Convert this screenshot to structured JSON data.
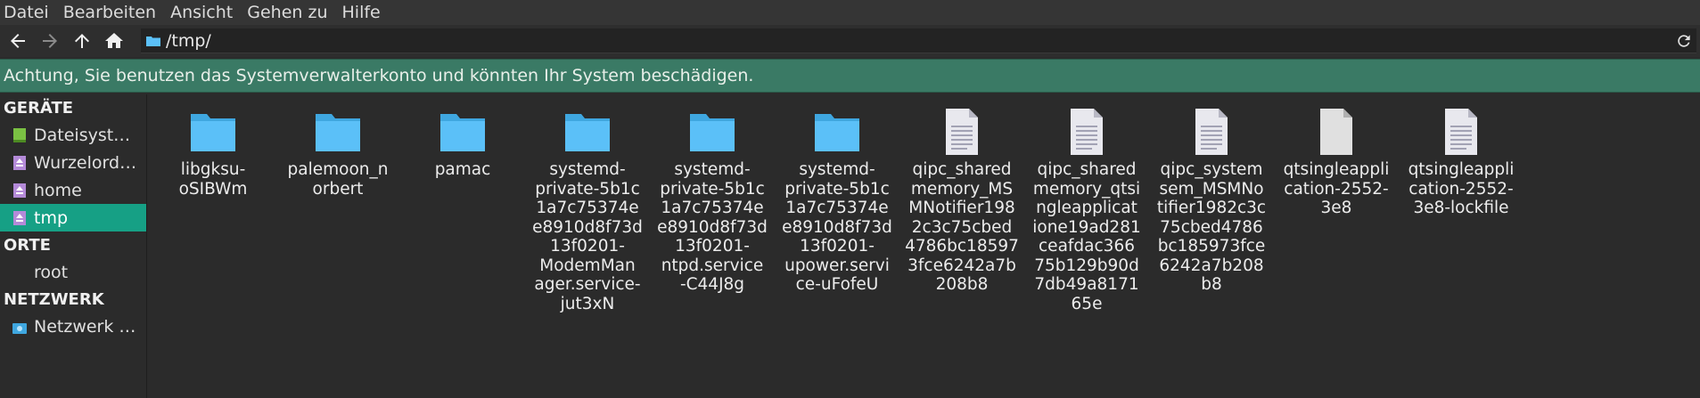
{
  "menu": [
    "Datei",
    "Bearbeiten",
    "Ansicht",
    "Gehen zu",
    "Hilfe"
  ],
  "address": {
    "path": "/tmp/"
  },
  "warning": "Achtung, Sie benutzen das Systemverwalterkonto und könnten Ihr System beschädigen.",
  "sidebar": {
    "sections": [
      {
        "title": "GERÄTE",
        "items": [
          {
            "label": "Dateisyst…",
            "icon": "drive-icon"
          },
          {
            "label": "Wurzelord…",
            "icon": "eject-drive-icon"
          },
          {
            "label": "home",
            "icon": "eject-drive-icon"
          },
          {
            "label": "tmp",
            "icon": "eject-drive-icon",
            "active": true
          }
        ]
      },
      {
        "title": "ORTE",
        "items": [
          {
            "label": "root",
            "icon": ""
          }
        ]
      },
      {
        "title": "NETZWERK",
        "items": [
          {
            "label": "Netzwerk …",
            "icon": "network-icon"
          }
        ]
      }
    ]
  },
  "files": [
    {
      "name": "libgksu-oSIBWm",
      "type": "folder"
    },
    {
      "name": "palemoon_norbert",
      "type": "folder"
    },
    {
      "name": "pamac",
      "type": "folder"
    },
    {
      "name": "systemd-private-5b1c1a7c75374ee8910d8f73d13f0201-ModemManager.service-jut3xN",
      "type": "folder"
    },
    {
      "name": "systemd-private-5b1c1a7c75374ee8910d8f73d13f0201-ntpd.service-C44J8g",
      "type": "folder"
    },
    {
      "name": "systemd-private-5b1c1a7c75374ee8910d8f73d13f0201-upower.service-uFofeU",
      "type": "folder"
    },
    {
      "name": "qipc_sharedmemory_MSMNotifier1982c3c75cbed4786bc185973fce6242a7b208b8",
      "type": "text"
    },
    {
      "name": "qipc_sharedmemory_qtsingleapplicatione19ad281ceafdac36675b129b90d7db49a817165e",
      "type": "text"
    },
    {
      "name": "qipc_systemsem_MSMNotifier1982c3c75cbed4786bc185973fce6242a7b208b8",
      "type": "text"
    },
    {
      "name": "qtsingleapplication-2552-3e8",
      "type": "blank"
    },
    {
      "name": "qtsingleapplication-2552-3e8-lockfile",
      "type": "text"
    }
  ],
  "file_lines": [
    [
      "libgksu-",
      "oSIBWm"
    ],
    [
      "palemoon_n",
      "orbert"
    ],
    [
      "pamac"
    ],
    [
      "systemd-",
      "private-5b1c",
      "1a7c75374e",
      "e8910d8f73d",
      "13f0201-",
      "ModemMan",
      "ager.service-",
      "jut3xN"
    ],
    [
      "systemd-",
      "private-5b1c",
      "1a7c75374e",
      "e8910d8f73d",
      "13f0201-",
      "ntpd.service",
      "-C44J8g"
    ],
    [
      "systemd-",
      "private-5b1c",
      "1a7c75374e",
      "e8910d8f73d",
      "13f0201-",
      "upower.servi",
      "ce-uFofeU"
    ],
    [
      "qipc_shared",
      "memory_MS",
      "MNotifier198",
      "2c3c75cbed",
      "4786bc18597",
      "3fce6242a7b",
      "208b8"
    ],
    [
      "qipc_shared",
      "memory_qtsi",
      "ngleapplicat",
      "ione19ad281",
      "ceafdac366",
      "75b129b90d",
      "7db49a8171",
      "65e"
    ],
    [
      "qipc_system",
      "sem_MSMNo",
      "tifier1982c3c",
      "75cbed4786",
      "bc185973fce",
      "6242a7b208",
      "b8"
    ],
    [
      "qtsingleappli",
      "cation-2552-",
      "3e8"
    ],
    [
      "qtsingleappli",
      "cation-2552-",
      "3e8-lockfile"
    ]
  ],
  "colors": {
    "accent": "#16a085",
    "warning_bg": "#3a7a65",
    "folder": "#5bc0f8",
    "bg": "#2b2b2b"
  }
}
